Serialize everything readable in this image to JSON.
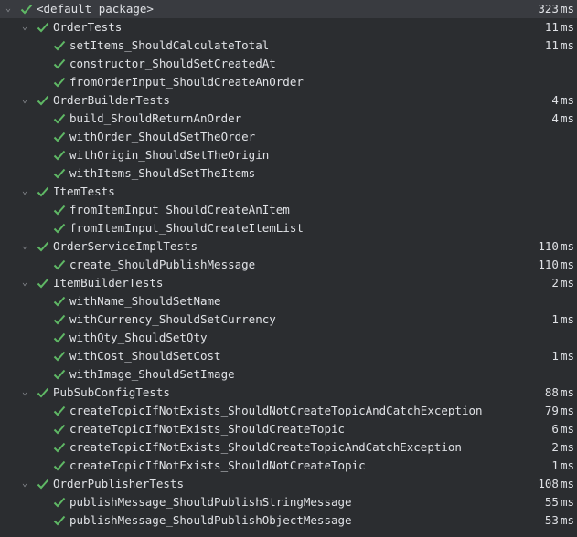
{
  "root": {
    "label": "<default package>",
    "time": "323",
    "unit": "ms",
    "icon": "check-icon",
    "expanded": true,
    "status_color": "#5fb865"
  },
  "suites": [
    {
      "label": "OrderTests",
      "time": "11",
      "unit": "ms",
      "tests": [
        {
          "label": "setItems_ShouldCalculateTotal",
          "time": "11",
          "unit": "ms"
        },
        {
          "label": "constructor_ShouldSetCreatedAt",
          "time": "",
          "unit": ""
        },
        {
          "label": "fromOrderInput_ShouldCreateAnOrder",
          "time": "",
          "unit": ""
        }
      ]
    },
    {
      "label": "OrderBuilderTests",
      "time": "4",
      "unit": "ms",
      "tests": [
        {
          "label": "build_ShouldReturnAnOrder",
          "time": "4",
          "unit": "ms"
        },
        {
          "label": "withOrder_ShouldSetTheOrder",
          "time": "",
          "unit": ""
        },
        {
          "label": "withOrigin_ShouldSetTheOrigin",
          "time": "",
          "unit": ""
        },
        {
          "label": "withItems_ShouldSetTheItems",
          "time": "",
          "unit": ""
        }
      ]
    },
    {
      "label": "ItemTests",
      "time": "",
      "unit": "",
      "tests": [
        {
          "label": "fromItemInput_ShouldCreateAnItem",
          "time": "",
          "unit": ""
        },
        {
          "label": "fromItemInput_ShouldCreateItemList",
          "time": "",
          "unit": ""
        }
      ]
    },
    {
      "label": "OrderServiceImplTests",
      "time": "110",
      "unit": "ms",
      "tests": [
        {
          "label": "create_ShouldPublishMessage",
          "time": "110",
          "unit": "ms"
        }
      ]
    },
    {
      "label": "ItemBuilderTests",
      "time": "2",
      "unit": "ms",
      "tests": [
        {
          "label": "withName_ShouldSetName",
          "time": "",
          "unit": ""
        },
        {
          "label": "withCurrency_ShouldSetCurrency",
          "time": "1",
          "unit": "ms"
        },
        {
          "label": "withQty_ShouldSetQty",
          "time": "",
          "unit": ""
        },
        {
          "label": "withCost_ShouldSetCost",
          "time": "1",
          "unit": "ms"
        },
        {
          "label": "withImage_ShouldSetImage",
          "time": "",
          "unit": ""
        }
      ]
    },
    {
      "label": "PubSubConfigTests",
      "time": "88",
      "unit": "ms",
      "tests": [
        {
          "label": "createTopicIfNotExists_ShouldNotCreateTopicAndCatchException",
          "time": "79",
          "unit": "ms"
        },
        {
          "label": "createTopicIfNotExists_ShouldCreateTopic",
          "time": "6",
          "unit": "ms"
        },
        {
          "label": "createTopicIfNotExists_ShouldCreateTopicAndCatchException",
          "time": "2",
          "unit": "ms"
        },
        {
          "label": "createTopicIfNotExists_ShouldNotCreateTopic",
          "time": "1",
          "unit": "ms"
        }
      ]
    },
    {
      "label": "OrderPublisherTests",
      "time": "108",
      "unit": "ms",
      "tests": [
        {
          "label": "publishMessage_ShouldPublishStringMessage",
          "time": "55",
          "unit": "ms"
        },
        {
          "label": "publishMessage_ShouldPublishObjectMessage",
          "time": "53",
          "unit": "ms"
        }
      ]
    }
  ]
}
